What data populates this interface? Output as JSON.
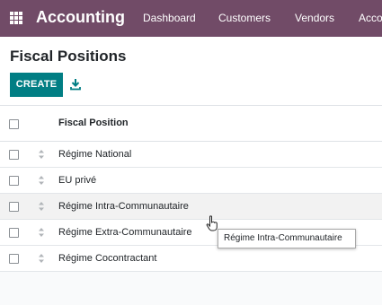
{
  "topbar": {
    "app_name": "Accounting",
    "nav": [
      "Dashboard",
      "Customers",
      "Vendors",
      "Acco"
    ],
    "colors": {
      "background": "#714b67",
      "text": "#ffffff"
    },
    "icons": {
      "apps": "apps-grid-icon"
    }
  },
  "control_panel": {
    "title": "Fiscal Positions",
    "create_label": "CREATE",
    "create_color": "#017e84",
    "icons": {
      "export": "download-icon"
    }
  },
  "list": {
    "column_header": "Fiscal Position",
    "rows": [
      "Régime National",
      "EU privé",
      "Régime Intra-Communautaire",
      "Régime Extra-Communautaire",
      "Régime Cocontractant"
    ],
    "hovered_row": "Régime Intra-Communautaire",
    "icons": {
      "handle": "drag-handle-icon"
    }
  },
  "tooltip": {
    "text": "Régime Intra-Communautaire"
  }
}
